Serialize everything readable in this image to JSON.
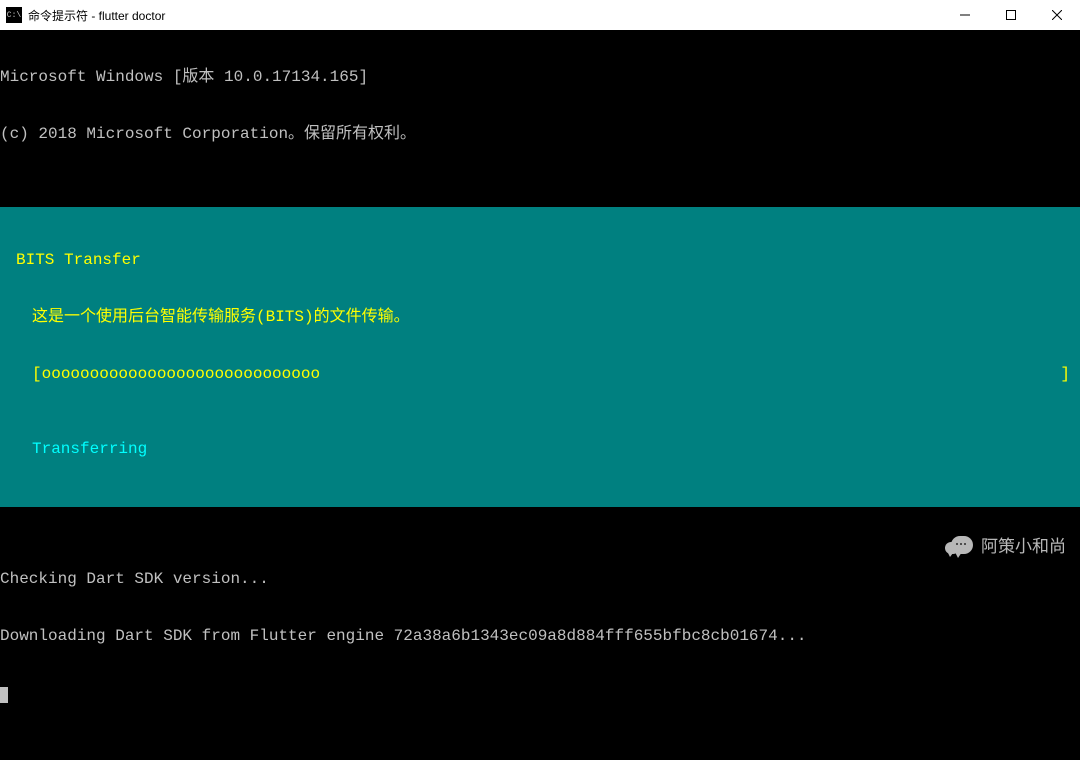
{
  "titlebar": {
    "icon_text": "C:\\",
    "title": "命令提示符 - flutter  doctor"
  },
  "header": {
    "line1": "Microsoft Windows [版本 10.0.17134.165]",
    "line2": "(c) 2018 Microsoft Corporation。保留所有权利。"
  },
  "progress": {
    "title": "BITS Transfer",
    "description": "这是一个使用后台智能传输服务(BITS)的文件传输。",
    "bar_open": "[",
    "bar_fill": "ooooooooooooooooooooooooooooo",
    "bar_close": "]",
    "status": "Transferring"
  },
  "output": {
    "line1": "Checking Dart SDK version...",
    "line2": "Downloading Dart SDK from Flutter engine 72a38a6b1343ec09a8d884fff655bfbc8cb01674..."
  },
  "watermark": {
    "text": "阿策小和尚"
  }
}
